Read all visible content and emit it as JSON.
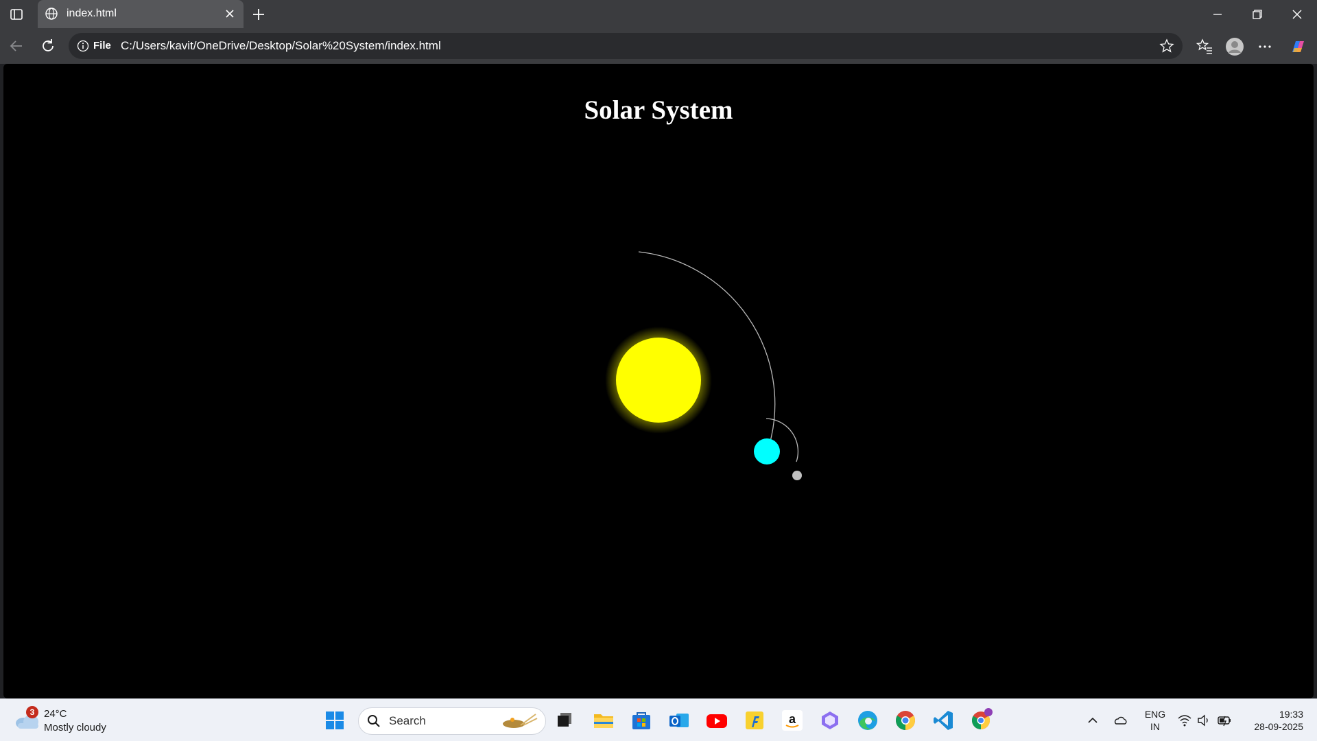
{
  "browser": {
    "tab": {
      "title": "index.html"
    },
    "address": {
      "scheme_label": "File",
      "url": "C:/Users/kavit/OneDrive/Desktop/Solar%20System/index.html"
    }
  },
  "page": {
    "title": "Solar System",
    "bodies": {
      "sun_color": "#ffff00",
      "planet_color": "#00ffff",
      "moon_color": "#c0c0c0",
      "background": "#000000"
    }
  },
  "taskbar": {
    "weather": {
      "badge": "3",
      "temperature": "24°C",
      "condition": "Mostly cloudy"
    },
    "search": {
      "label": "Search"
    },
    "apps": [
      "windows-start",
      "search",
      "task-view",
      "file-explorer",
      "microsoft-store",
      "outlook",
      "youtube",
      "flipkart",
      "amazon",
      "copilot",
      "edge",
      "chrome",
      "vscode",
      "chrome-profile"
    ],
    "language": {
      "line1": "ENG",
      "line2": "IN"
    },
    "clock": {
      "time": "19:33",
      "date": "28-09-2025"
    }
  }
}
